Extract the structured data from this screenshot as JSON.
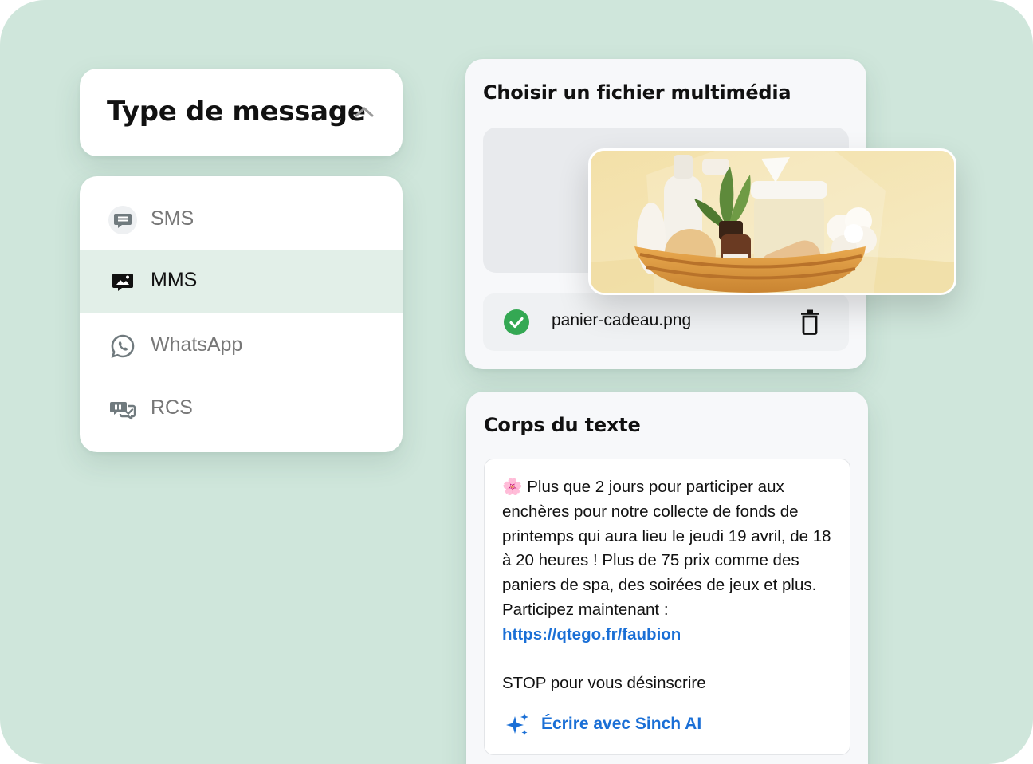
{
  "message_type": {
    "title": "Type de message",
    "options": [
      {
        "label": "SMS",
        "icon": "sms-icon"
      },
      {
        "label": "MMS",
        "icon": "mms-icon",
        "selected": true
      },
      {
        "label": "WhatsApp",
        "icon": "whatsapp-icon"
      },
      {
        "label": "RCS",
        "icon": "rcs-icon"
      }
    ]
  },
  "media": {
    "title": "Choisir un fichier multimédia",
    "file_name": "panier-cadeau.png",
    "preview_image": "gift-basket-photo"
  },
  "body": {
    "title": "Corps du texte",
    "emoji": "🌸",
    "message": "Plus que 2 jours pour participer aux enchères pour notre collecte de fonds de printemps qui aura lieu le jeudi 19 avril, de 18 à 20 heures ! Plus de 75 prix comme des paniers de spa, des soirées de jeux et plus. Participez maintenant :",
    "link": "https://qtego.fr/faubion",
    "footer": "STOP pour vous désinscrire",
    "ai_action": "Écrire avec Sinch AI"
  },
  "colors": {
    "background": "#cfe6db",
    "selected_row": "#e2efe8",
    "link": "#1a6fd6",
    "success": "#34a853"
  }
}
